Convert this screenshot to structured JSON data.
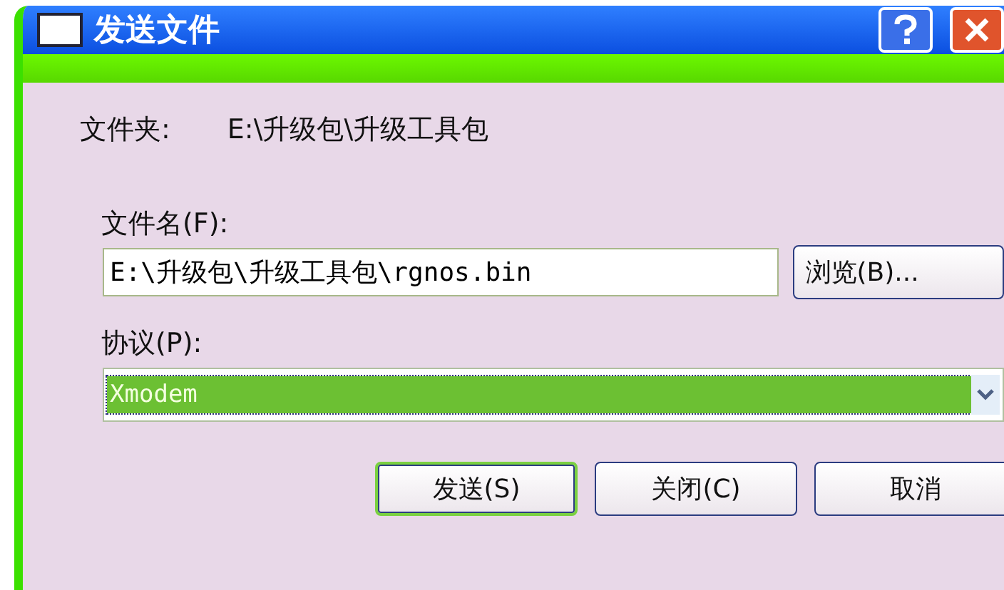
{
  "window": {
    "title": "发送文件"
  },
  "folder": {
    "label": "文件夹:",
    "path": "E:\\升级包\\升级工具包"
  },
  "file_name": {
    "label": "文件名(F):",
    "value": "E:\\升级包\\升级工具包\\rgnos.bin",
    "browse_button": "浏览(B)..."
  },
  "protocol": {
    "label": "协议(P):",
    "value": "Xmodem",
    "selected": true
  },
  "buttons": [
    {
      "label": "发送(S)",
      "default": true
    },
    {
      "label": "关闭(C)",
      "default": false
    },
    {
      "label": "取消",
      "default": false
    }
  ]
}
